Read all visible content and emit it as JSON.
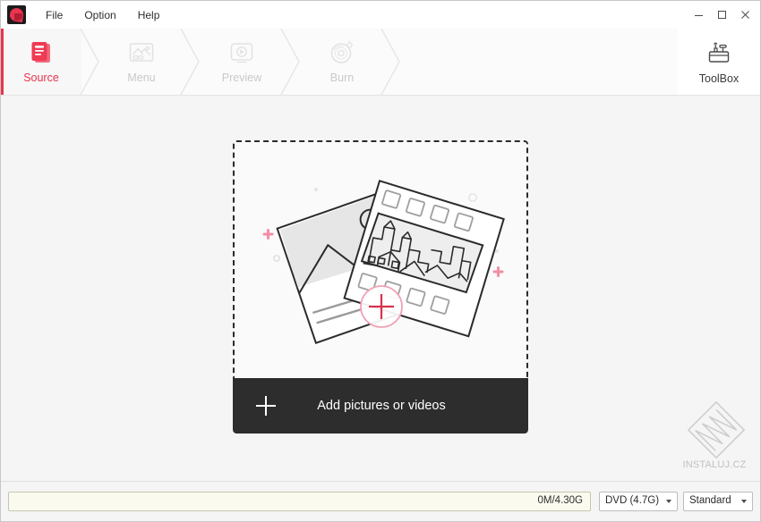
{
  "window": {
    "menus": [
      {
        "label": "File"
      },
      {
        "label": "Option"
      },
      {
        "label": "Help"
      }
    ],
    "controls": {
      "minimize": "minimize-icon",
      "maximize": "maximize-icon",
      "close": "close-icon"
    },
    "logo_icon": "app-logo-icon"
  },
  "toolbar": {
    "steps": [
      {
        "label": "Source",
        "icon": "documents-icon",
        "active": true
      },
      {
        "label": "Menu",
        "icon": "picture-frame-icon",
        "active": false
      },
      {
        "label": "Preview",
        "icon": "play-screen-icon",
        "active": false
      },
      {
        "label": "Burn",
        "icon": "disc-burn-icon",
        "active": false
      }
    ],
    "toolbox": {
      "label": "ToolBox",
      "icon": "toolbox-icon"
    },
    "accent_color": "#e8344f",
    "inactive_color": "#c9c9c9"
  },
  "main": {
    "dropzone": {
      "illustration_icon": "photos-and-film-illustration",
      "add_circle_icon": "add-plus-circle-icon"
    },
    "add_button": {
      "label": "Add pictures or videos",
      "icon": "plus-icon"
    }
  },
  "statusbar": {
    "progress": {
      "text": "0M/4.30G",
      "percent": 0,
      "fill_color": "#fbfaef"
    },
    "disc_select": {
      "value": "DVD (4.7G)",
      "icon": "chevron-down-icon"
    },
    "quality_select": {
      "value": "Standard",
      "icon": "chevron-down-icon"
    }
  },
  "watermark": {
    "text": "INSTALUJ.CZ",
    "icon": "instaluj-diamond-logo"
  }
}
